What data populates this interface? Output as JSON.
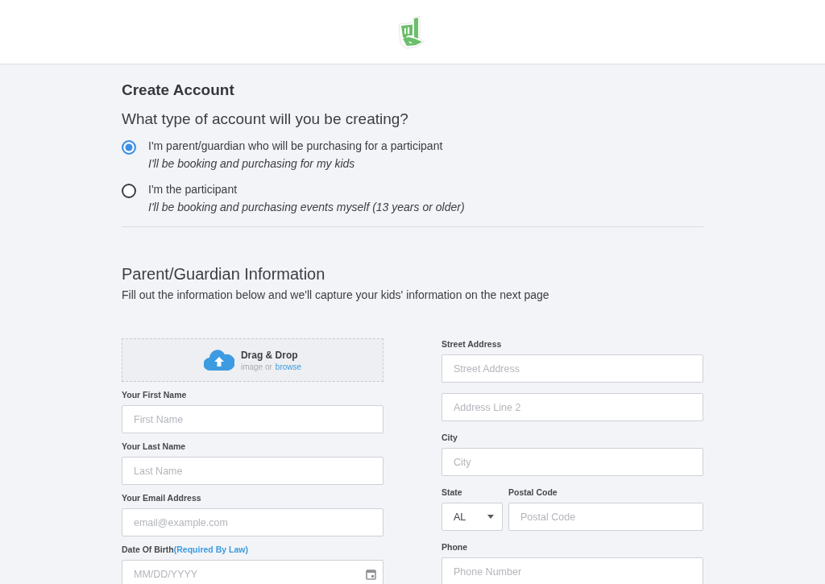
{
  "page": {
    "title": "Create Account",
    "question": "What type of account will you be creating?",
    "account_types": [
      {
        "label": "I'm parent/guardian who will be purchasing for a participant",
        "description": "I'll be booking and purchasing for my kids",
        "selected": true
      },
      {
        "label": "I'm the participant",
        "description": "I'll be booking and purchasing events myself (13 years or older)",
        "selected": false
      }
    ],
    "section": {
      "title": "Parent/Guardian Information",
      "subtitle": "Fill out the information below and we'll capture your kids' information on the next page"
    },
    "upload": {
      "title": "Drag & Drop",
      "hint": "image or",
      "link": "browse"
    },
    "left_fields": [
      {
        "kind": "text",
        "label": "Your First Name",
        "placeholder": "First Name"
      },
      {
        "kind": "text",
        "label": "Your Last Name",
        "placeholder": "Last Name"
      },
      {
        "kind": "text",
        "label": "Your Email Address",
        "placeholder": "email@example.com"
      },
      {
        "kind": "date",
        "label": "Date Of Birth",
        "note": "(Required By Law)",
        "placeholder": "MM/DD/YYYY"
      }
    ],
    "right_fields": [
      {
        "kind": "text",
        "label": "Street Address",
        "placeholder": "Street Address"
      },
      {
        "kind": "text",
        "placeholder": "Address Line 2"
      },
      {
        "kind": "text",
        "label": "City",
        "placeholder": "City"
      },
      {
        "kind": "pair",
        "items": [
          {
            "kind": "select",
            "label": "State",
            "value": "AL"
          },
          {
            "kind": "text",
            "label": "Postal Code",
            "placeholder": "Postal Code"
          }
        ]
      },
      {
        "kind": "text",
        "label": "Phone",
        "placeholder": "Phone Number"
      }
    ]
  }
}
